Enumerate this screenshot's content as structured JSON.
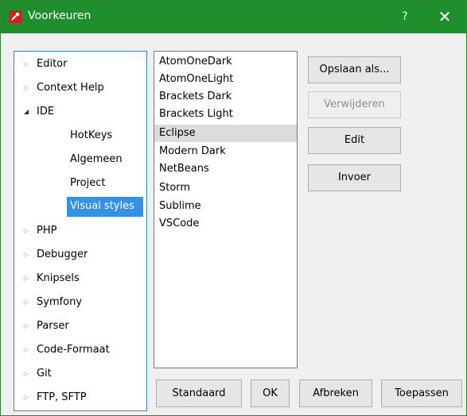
{
  "window": {
    "title": "Voorkeuren",
    "help_label": "?",
    "close_label": "✕"
  },
  "tree": {
    "items": [
      {
        "label": "Editor",
        "expanded": false
      },
      {
        "label": "Context Help",
        "expanded": false
      },
      {
        "label": "IDE",
        "expanded": true
      },
      {
        "label": "PHP",
        "expanded": false
      },
      {
        "label": "Debugger",
        "expanded": false
      },
      {
        "label": "Knipsels",
        "expanded": false
      },
      {
        "label": "Symfony",
        "expanded": false
      },
      {
        "label": "Parser",
        "expanded": false
      },
      {
        "label": "Code-Formaat",
        "expanded": false
      },
      {
        "label": "Git",
        "expanded": false
      },
      {
        "label": "FTP, SFTP",
        "expanded": false
      }
    ],
    "ide_children": [
      "HotKeys",
      "Algemeen",
      "Project",
      "Visual styles"
    ],
    "selected": "Visual styles"
  },
  "styles": {
    "items": [
      "AtomOneDark",
      "AtomOneLight",
      "Brackets Dark",
      "Brackets Light",
      "Eclipse",
      "Modern Dark",
      "NetBeans",
      "Storm",
      "Sublime",
      "VSCode"
    ],
    "selected": "Eclipse"
  },
  "buttons": {
    "save_as": "Opslaan als...",
    "remove": "Verwijderen",
    "edit": "Edit",
    "import": "Invoer",
    "default": "Standaard",
    "ok": "OK",
    "cancel": "Afbreken",
    "apply": "Toepassen"
  },
  "colors": {
    "titlebar": "#1f8f2e",
    "selection": "#3392e6",
    "focus_border": "#3b86d4"
  }
}
